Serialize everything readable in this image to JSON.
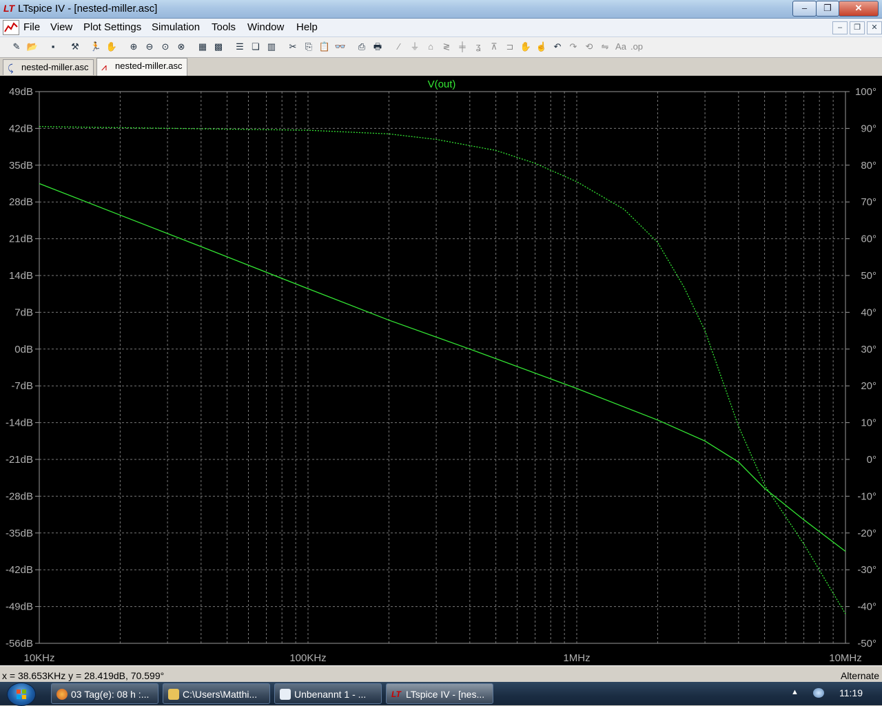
{
  "window": {
    "title": "LTspice IV - [nested-miller.asc]",
    "minimize_glyph": "–",
    "maximize_glyph": "❐",
    "close_glyph": "✕"
  },
  "menu": {
    "items": [
      "File",
      "View",
      "Plot Settings",
      "Simulation",
      "Tools",
      "Window",
      "Help"
    ],
    "mdi_minimize_glyph": "–",
    "mdi_restore_glyph": "❐",
    "mdi_close_glyph": "✕"
  },
  "toolbar": {
    "icons": [
      "open-schematic-icon",
      "open-file-icon",
      "save-icon",
      "control-panel-icon",
      "run-icon",
      "halt-icon",
      "zoom-in-icon",
      "zoom-out-icon",
      "zoom-fit-icon",
      "zoom-cancel-icon",
      "autorange-icon",
      "grid-icon",
      "tile-horizontal-icon",
      "cascade-icon",
      "tile-vertical-icon",
      "cut-icon",
      "copy-icon",
      "paste-icon",
      "find-icon",
      "print-preview-icon",
      "print-icon",
      "wire-icon",
      "ground-icon",
      "label-icon",
      "resistor-icon",
      "capacitor-icon",
      "inductor-icon",
      "diode-icon",
      "component-icon",
      "move-icon",
      "drag-icon",
      "undo-icon",
      "redo-icon",
      "rotate-icon",
      "mirror-icon",
      "text-icon",
      "spice-directive-icon"
    ]
  },
  "tabs": [
    {
      "label": "nested-miller.asc",
      "type": "schematic",
      "active": false
    },
    {
      "label": "nested-miller.asc",
      "type": "waveform",
      "active": true
    }
  ],
  "plot": {
    "background": "#000000",
    "trace_color": "#33e633",
    "grid_color": "#7a7a7a",
    "text_color": "#b0b0b0"
  },
  "chart_data": {
    "type": "line",
    "title": "V(out)",
    "x_scale": "log",
    "xlim": [
      10000,
      10000000
    ],
    "x_tick_labels": [
      "10KHz",
      "100KHz",
      "1MHz",
      "10MHz"
    ],
    "y_left_ticks": [
      "49dB",
      "42dB",
      "35dB",
      "28dB",
      "21dB",
      "14dB",
      "7dB",
      "0dB",
      "-7dB",
      "-14dB",
      "-21dB",
      "-28dB",
      "-35dB",
      "-42dB",
      "-49dB",
      "-56dB"
    ],
    "y_left_lim": [
      -56,
      49
    ],
    "y_right_ticks": [
      "100°",
      "90°",
      "80°",
      "70°",
      "60°",
      "50°",
      "40°",
      "30°",
      "20°",
      "10°",
      "0°",
      "-10°",
      "-20°",
      "-30°",
      "-40°",
      "-50°"
    ],
    "y_right_lim": [
      -50,
      100
    ],
    "series": [
      {
        "kind": "magnitude",
        "unit": "dB",
        "axis": "left",
        "line_style": "solid",
        "x": [
          10000,
          20000,
          40000,
          100000,
          200000,
          400000,
          1000000,
          2000000,
          3000000,
          4000000,
          5000000,
          7000000,
          10000000
        ],
        "y": [
          31.5,
          25.5,
          19.5,
          11.5,
          5.5,
          0,
          -7.5,
          -13.5,
          -17.5,
          -21.5,
          -26.5,
          -32.5,
          -38.5
        ]
      },
      {
        "kind": "phase",
        "unit": "°",
        "axis": "right",
        "line_style": "dashed",
        "x": [
          10000,
          100000,
          200000,
          300000,
          500000,
          700000,
          1000000,
          1500000,
          2000000,
          2500000,
          3000000,
          4000000,
          5000000,
          7000000,
          10000000
        ],
        "y": [
          90.5,
          89.5,
          88.5,
          87,
          84,
          80.5,
          75.5,
          68,
          59,
          47,
          35,
          9,
          -7,
          -23,
          -42
        ]
      }
    ]
  },
  "status": {
    "cursor_text": "x = 38.653KHz    y = 28.419dB, 70.599°",
    "mode_text": "Alternate"
  },
  "taskbar": {
    "items": [
      {
        "label": "03 Tag(e): 08 h :...",
        "active": false
      },
      {
        "label": "C:\\Users\\Matthi...",
        "active": false
      },
      {
        "label": "Unbenannt 1 - ...",
        "active": false
      },
      {
        "label": "LTspice IV - [nes...",
        "active": true
      }
    ],
    "clock": "11:19",
    "tray_arrow": "▲"
  }
}
